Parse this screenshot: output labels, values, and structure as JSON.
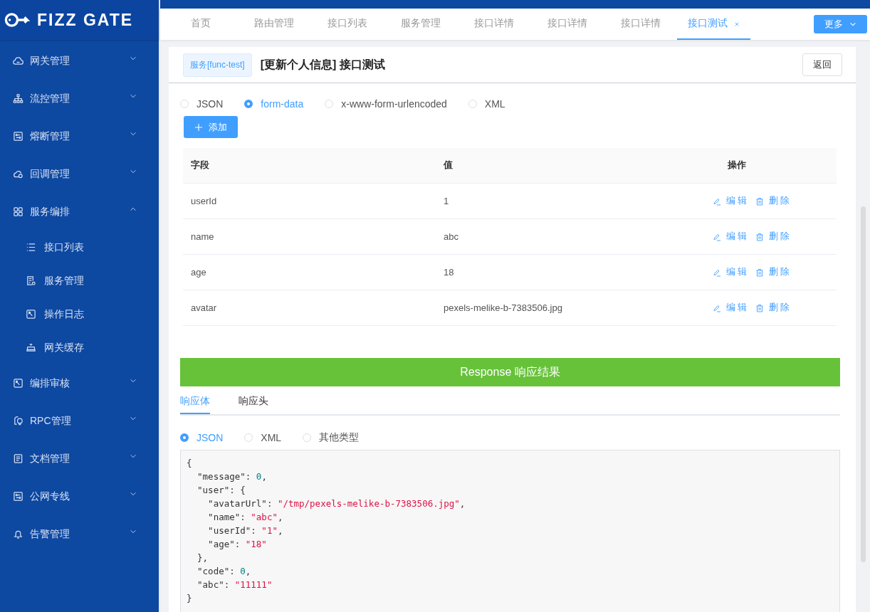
{
  "logo": {
    "text": "FIZZ GATE"
  },
  "sidebar": {
    "items": [
      {
        "label": "网关管理",
        "kind": "cloud",
        "expanded": false
      },
      {
        "label": "流控管理",
        "kind": "tree",
        "expanded": false
      },
      {
        "label": "熔断管理",
        "kind": "panel",
        "expanded": false
      },
      {
        "label": "回调管理",
        "kind": "cloud2",
        "expanded": false
      },
      {
        "label": "服务编排",
        "kind": "grid",
        "expanded": true,
        "children": [
          {
            "label": "接口列表",
            "kind": "list"
          },
          {
            "label": "服务管理",
            "kind": "doc"
          },
          {
            "label": "操作日志",
            "kind": "wrench"
          },
          {
            "label": "网关缓存",
            "kind": "tray"
          }
        ]
      },
      {
        "label": "编排审核",
        "kind": "wrench",
        "expanded": false
      },
      {
        "label": "RPC管理",
        "kind": "bulb",
        "expanded": false
      },
      {
        "label": "文档管理",
        "kind": "page",
        "expanded": false
      },
      {
        "label": "公网专线",
        "kind": "panel",
        "expanded": false
      },
      {
        "label": "告警管理",
        "kind": "bell",
        "expanded": false
      }
    ]
  },
  "tabs": [
    {
      "label": "首页",
      "selected": false,
      "closable": false
    },
    {
      "label": "路由管理",
      "selected": false,
      "closable": false
    },
    {
      "label": "接口列表",
      "selected": false,
      "closable": false
    },
    {
      "label": "服务管理",
      "selected": false,
      "closable": false
    },
    {
      "label": "接口详情",
      "selected": false,
      "closable": false
    },
    {
      "label": "接口详情",
      "selected": false,
      "closable": false
    },
    {
      "label": "接口详情",
      "selected": false,
      "closable": false
    },
    {
      "label": "接口测试",
      "selected": true,
      "closable": true
    }
  ],
  "more_button": "更多",
  "header": {
    "tag": "服务[func-test]",
    "title": "[更新个人信息] 接口测试",
    "back_button": "返回"
  },
  "body_types": [
    {
      "label": "JSON",
      "selected": false
    },
    {
      "label": "form-data",
      "selected": true
    },
    {
      "label": "x-www-form-urlencoded",
      "selected": false
    },
    {
      "label": "XML",
      "selected": false
    }
  ],
  "add_button": "添加",
  "table": {
    "columns": [
      "字段",
      "值",
      "操作"
    ],
    "rows": [
      {
        "field": "userId",
        "value": "1",
        "edit": "编 辑",
        "delete": "删 除"
      },
      {
        "field": "name",
        "value": "abc",
        "edit": "编 辑",
        "delete": "删 除"
      },
      {
        "field": "age",
        "value": "18",
        "edit": "编 辑",
        "delete": "删 除"
      },
      {
        "field": "avatar",
        "value": "pexels-melike-b-7383506.jpg",
        "edit": "编 辑",
        "delete": "删 除"
      }
    ]
  },
  "response": {
    "banner": "Response 响应结果",
    "tabs": [
      {
        "label": "响应体",
        "selected": true
      },
      {
        "label": "响应头",
        "selected": false
      }
    ],
    "formats": [
      {
        "label": "JSON",
        "selected": true
      },
      {
        "label": "XML",
        "selected": false
      },
      {
        "label": "其他类型",
        "selected": false
      }
    ],
    "code_lines": [
      [
        {
          "kind": "punct",
          "text": "{"
        }
      ],
      [
        {
          "kind": "punct",
          "text": "  \"message\": "
        },
        {
          "kind": "number",
          "text": "0"
        },
        {
          "kind": "punct",
          "text": ","
        }
      ],
      [
        {
          "kind": "punct",
          "text": "  \"user\": {"
        }
      ],
      [
        {
          "kind": "punct",
          "text": "    \"avatarUrl\": "
        },
        {
          "kind": "string",
          "text": "\"/tmp/pexels-melike-b-7383506.jpg\""
        },
        {
          "kind": "punct",
          "text": ","
        }
      ],
      [
        {
          "kind": "punct",
          "text": "    \"name\": "
        },
        {
          "kind": "string",
          "text": "\"abc\""
        },
        {
          "kind": "punct",
          "text": ","
        }
      ],
      [
        {
          "kind": "punct",
          "text": "    \"userId\": "
        },
        {
          "kind": "string",
          "text": "\"1\""
        },
        {
          "kind": "punct",
          "text": ","
        }
      ],
      [
        {
          "kind": "punct",
          "text": "    \"age\": "
        },
        {
          "kind": "string",
          "text": "\"18\""
        }
      ],
      [
        {
          "kind": "punct",
          "text": "  },"
        }
      ],
      [
        {
          "kind": "punct",
          "text": "  \"code\": "
        },
        {
          "kind": "number",
          "text": "0"
        },
        {
          "kind": "punct",
          "text": ","
        }
      ],
      [
        {
          "kind": "punct",
          "text": "  \"abc\": "
        },
        {
          "kind": "string",
          "text": "\"11111\""
        }
      ],
      [
        {
          "kind": "punct",
          "text": "}"
        }
      ]
    ]
  }
}
